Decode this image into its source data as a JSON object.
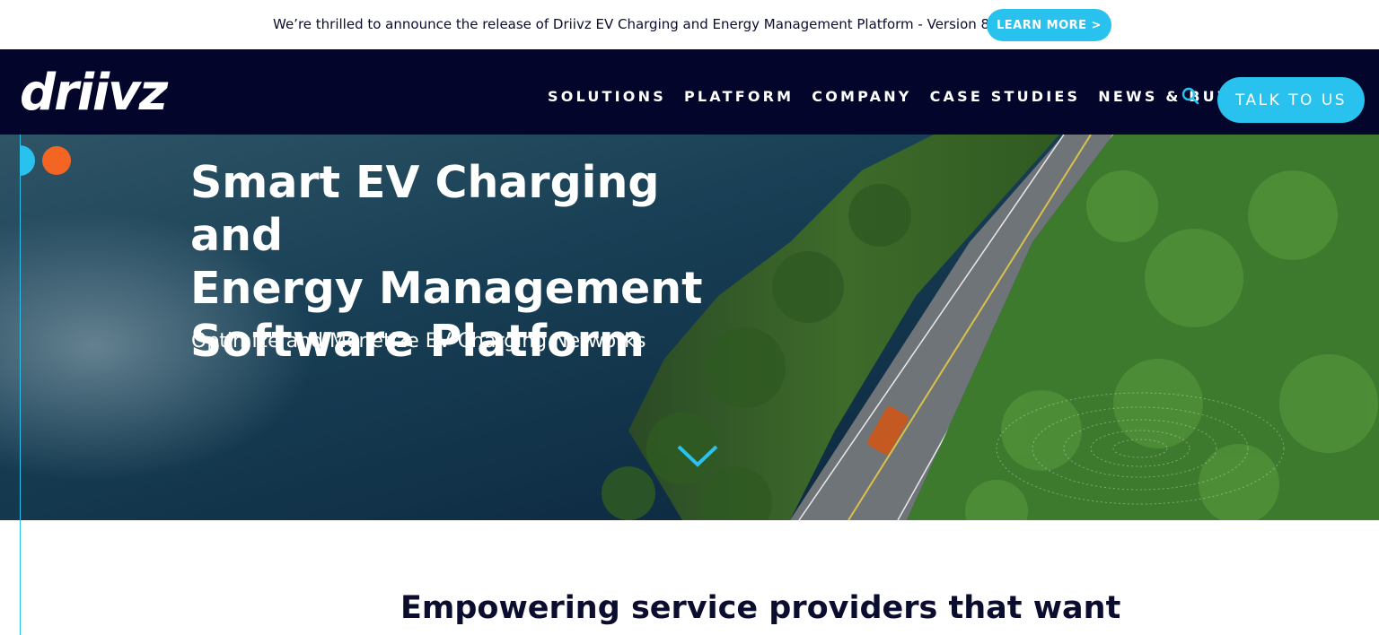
{
  "announcement": {
    "text": "We’re thrilled to announce the release of Driivz EV Charging and Energy Management Platform - Version 8",
    "cta_label": "LEARN MORE >"
  },
  "header": {
    "logo_text": "driivz",
    "nav": [
      {
        "label": "SOLUTIONS"
      },
      {
        "label": "PLATFORM"
      },
      {
        "label": "COMPANY"
      },
      {
        "label": "CASE STUDIES"
      },
      {
        "label": "NEWS & BUZZ"
      }
    ],
    "search_icon": "search-icon",
    "cta_label": "TALK TO US"
  },
  "hero": {
    "title_lines": [
      "Smart EV Charging and",
      "Energy Management",
      "Software Platform"
    ],
    "subtitle": "Optimize and Monetize EV Charging Networks",
    "scroll_icon": "chevron-down-icon"
  },
  "section": {
    "heading": "Empowering service providers that want"
  },
  "colors": {
    "accent": "#29c2ee",
    "navy": "#03052a",
    "orange": "#f26522",
    "text_dark": "#0b0d2e"
  }
}
